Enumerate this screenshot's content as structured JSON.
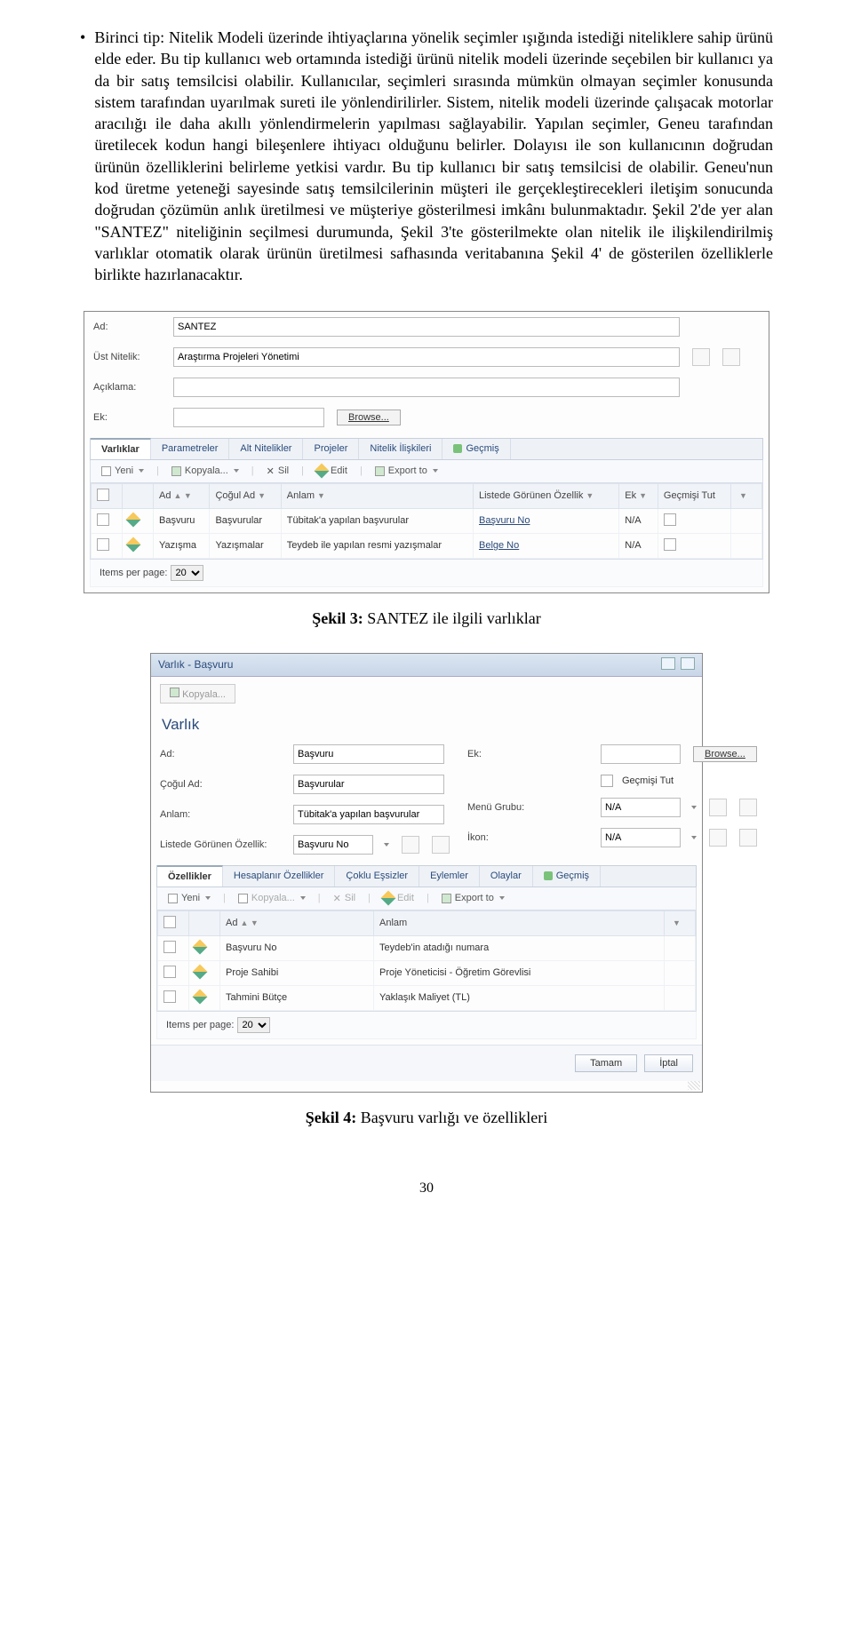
{
  "bullet": "•",
  "paragraph": "Birinci tip: Nitelik Modeli üzerinde ihtiyaçlarına yönelik seçimler ışığında istediği niteliklere sahip ürünü elde eder. Bu tip kullanıcı web ortamında istediği ürünü nitelik modeli üzerinde seçebilen bir kullanıcı ya da bir satış temsilcisi olabilir. Kullanıcılar, seçimleri sırasında mümkün olmayan seçimler konusunda sistem tarafından uyarılmak sureti ile yönlendirilirler. Sistem, nitelik modeli üzerinde çalışacak motorlar aracılığı ile daha akıllı yönlendirmelerin yapılması sağlayabilir. Yapılan seçimler, Geneu tarafından üretilecek kodun hangi bileşenlere ihtiyacı olduğunu belirler. Dolayısı ile son kullanıcının doğrudan ürünün özelliklerini belirleme yetkisi vardır. Bu tip kullanıcı bir satış temsilcisi de olabilir. Geneu'nun kod üretme yeteneği sayesinde satış temsilcilerinin müşteri ile gerçekleştirecekleri iletişim sonucunda doğrudan çözümün anlık üretilmesi ve müşteriye gösterilmesi imkânı bulunmaktadır. Şekil 2'de yer alan \"SANTEZ\" niteliğinin seçilmesi durumunda, Şekil 3'te gösterilmekte olan nitelik ile ilişkilendirilmiş varlıklar otomatik olarak ürünün üretilmesi safhasında veritabanına Şekil 4' de gösterilen özelliklerle birlikte hazırlanacaktır.",
  "fig3": {
    "label": "Şekil 3:",
    "text": " SANTEZ ile ilgili varlıklar"
  },
  "fig4": {
    "label": "Şekil 4:",
    "text": " Başvuru varlığı ve özellikleri"
  },
  "pagenum": "30",
  "s1": {
    "labels": {
      "ad": "Ad:",
      "ust": "Üst Nitelik:",
      "aciklama": "Açıklama:",
      "ek": "Ek:"
    },
    "vals": {
      "ad": "SANTEZ",
      "ust": "Araştırma Projeleri Yönetimi",
      "aciklama": "",
      "ek": ""
    },
    "browse": "Browse...",
    "tabs": [
      "Varlıklar",
      "Parametreler",
      "Alt Nitelikler",
      "Projeler",
      "Nitelik İlişkileri",
      "Geçmiş"
    ],
    "toolbar": {
      "yeni": "Yeni",
      "kopyala": "Kopyala...",
      "sil": "Sil",
      "edit": "Edit",
      "export": "Export to"
    },
    "headers": [
      "",
      "",
      "Ad",
      "Çoğul Ad",
      "Anlam",
      "Listede Görünen Özellik",
      "Ek",
      "Geçmişi Tut",
      ""
    ],
    "rows": [
      {
        "ad": "Başvuru",
        "cogul": "Başvurular",
        "anlam": "Tübitak'a yapılan başvurular",
        "liste": "Başvuru No",
        "ek": "",
        "gecmis": false,
        "na": "N/A"
      },
      {
        "ad": "Yazışma",
        "cogul": "Yazışmalar",
        "anlam": "Teydeb ile yapılan resmi yazışmalar",
        "liste": "Belge No",
        "ek": "",
        "gecmis": false,
        "na": "N/A"
      }
    ],
    "pager": {
      "label": "Items per page:",
      "val": "20"
    }
  },
  "s2": {
    "title": "Varlık - Başvuru",
    "copy": "Kopyala...",
    "sect": "Varlık",
    "labels": {
      "ad": "Ad:",
      "cogul": "Çoğul Ad:",
      "anlam": "Anlam:",
      "liste": "Listede Görünen Özellik:",
      "ek": "Ek:",
      "gecmis": "Geçmişi Tut",
      "menu": "Menü Grubu:",
      "ikon": "İkon:"
    },
    "vals": {
      "ad": "Başvuru",
      "cogul": "Başvurular",
      "anlam": "Tübitak'a yapılan başvurular",
      "liste": "Başvuru No",
      "menu": "N/A",
      "ikon": "N/A"
    },
    "browse": "Browse...",
    "tabs": [
      "Özellikler",
      "Hesaplanır Özellikler",
      "Çoklu Eşsizler",
      "Eylemler",
      "Olaylar",
      "Geçmiş"
    ],
    "toolbar": {
      "yeni": "Yeni",
      "kopyala": "Kopyala...",
      "sil": "Sil",
      "edit": "Edit",
      "export": "Export to"
    },
    "headers": [
      "",
      "",
      "Ad",
      "Anlam",
      ""
    ],
    "rows": [
      {
        "ad": "Başvuru No",
        "anlam": "Teydeb'in atadığı numara"
      },
      {
        "ad": "Proje Sahibi",
        "anlam": "Proje Yöneticisi - Öğretim Görevlisi"
      },
      {
        "ad": "Tahmini Bütçe",
        "anlam": "Yaklaşık Maliyet (TL)"
      }
    ],
    "pager": {
      "label": "Items per page:",
      "val": "20"
    },
    "buttons": {
      "ok": "Tamam",
      "cancel": "İptal"
    }
  }
}
